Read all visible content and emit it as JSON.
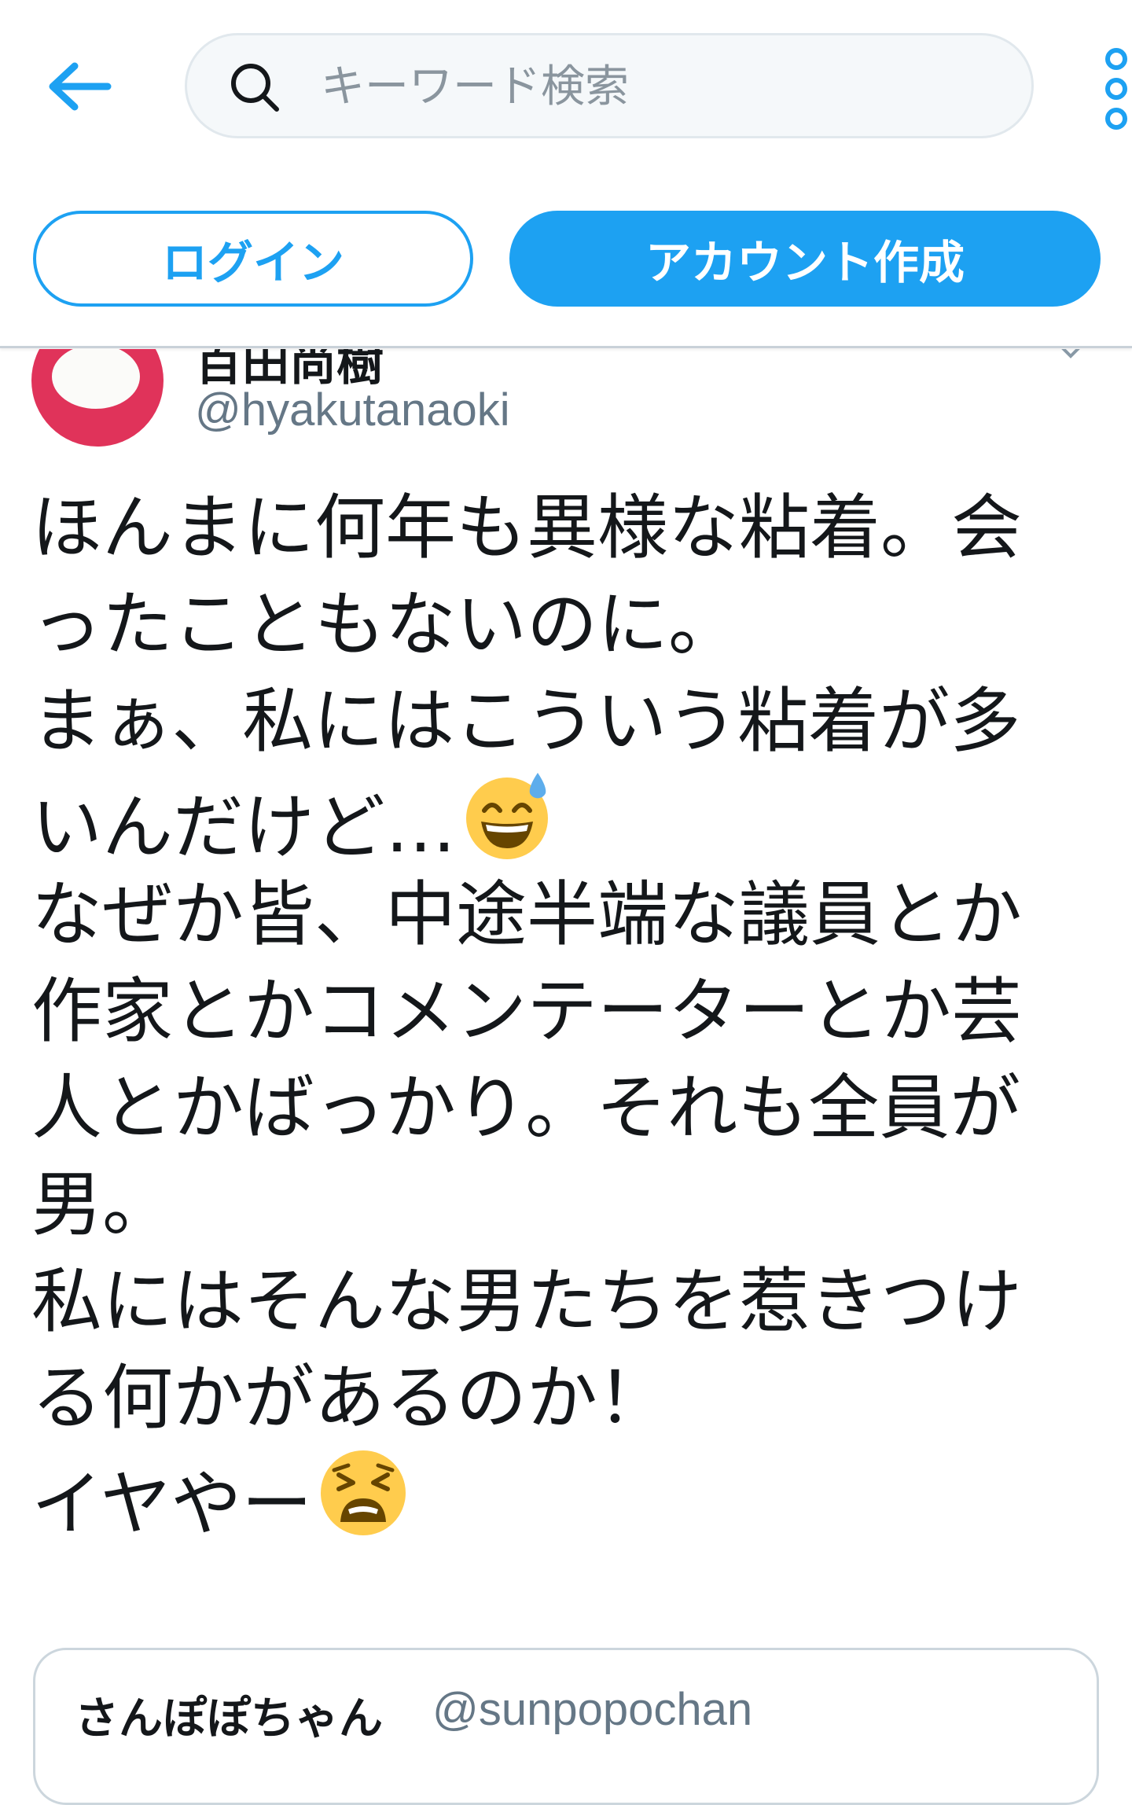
{
  "colors": {
    "accent": "#1da1f2",
    "avatar_bg": "#e0335a",
    "secondary_text": "#657786",
    "text": "#14171a"
  },
  "header": {
    "back_icon": "arrow-left-icon",
    "search": {
      "icon": "search-icon",
      "placeholder": "キーワード検索"
    },
    "more_icon": "more-vertical-icon"
  },
  "auth": {
    "login_label": "ログイン",
    "signup_label": "アカウント作成"
  },
  "tweet": {
    "display_name": "百田尚樹",
    "username": "@hyakutanaoki",
    "lines": [
      "ほんまに何年も異様な粘着。会",
      "ったこともないのに。",
      "まぁ、私にはこういう粘着が多",
      "いんだけど…",
      "なぜか皆、中途半端な議員とか",
      "作家とかコメンテーターとか芸",
      "人とかばっかり。それも全員が",
      "男。",
      "私にはそんな男たちを惹きつけ",
      "る何かがあるのか！",
      "イヤやー"
    ],
    "emojis": {
      "line_4": "grinning-sweat-emoji",
      "line_11": "tired-face-emoji"
    }
  },
  "quote": {
    "display_name": "さんぽぽちゃん",
    "username": "@sunpopochan"
  }
}
